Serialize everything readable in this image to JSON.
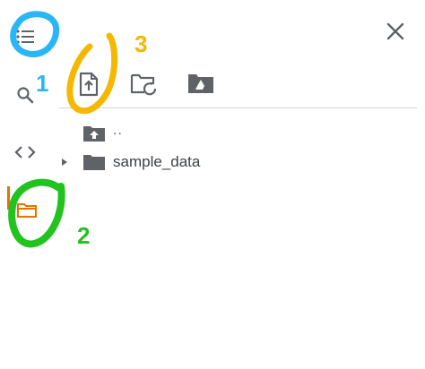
{
  "file_tree": {
    "items": [
      {
        "label": "..",
        "icon": "folder-up-icon"
      },
      {
        "label": "sample_data",
        "icon": "folder-icon",
        "expander": "chevron-right-icon"
      }
    ]
  },
  "toolbar": {
    "icons": [
      "upload-file-icon",
      "refresh-folder-icon",
      "mount-drive-icon"
    ]
  },
  "sidebar": {
    "icons": [
      "table-of-contents-icon",
      "search-icon",
      "code-snippets-icon",
      "files-icon"
    ]
  },
  "annotations": {
    "one": "1",
    "two": "2",
    "three": "3",
    "colors": {
      "one": "#29b6f6",
      "two": "#22c21f",
      "three": "#f5b800"
    }
  },
  "colors": {
    "icon": "#5f6368",
    "accent": "#e37400",
    "divider": "#d6d6d6"
  }
}
